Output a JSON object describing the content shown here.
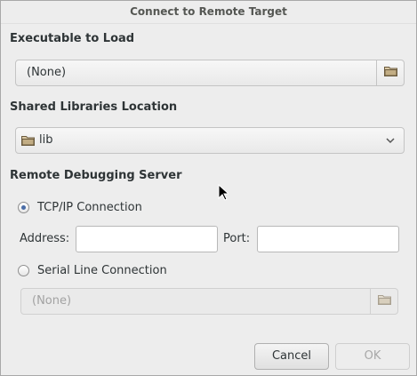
{
  "dialog": {
    "title": "Connect to Remote Target"
  },
  "executable": {
    "section": "Executable to Load",
    "value": "(None)",
    "browse_icon": "folder-icon"
  },
  "libraries": {
    "section": "Shared Libraries Location",
    "value": "lib",
    "folder_icon": "folder-icon",
    "dropdown_icon": "chevron-down-icon"
  },
  "server": {
    "section": "Remote Debugging Server",
    "tcp_label": "TCP/IP Connection",
    "tcp_selected": true,
    "address_label": "Address:",
    "address_value": "",
    "port_label": "Port:",
    "port_value": "",
    "serial_label": "Serial Line Connection",
    "serial_selected": false,
    "serial_value": "(None)"
  },
  "buttons": {
    "cancel": "Cancel",
    "ok": "OK"
  }
}
